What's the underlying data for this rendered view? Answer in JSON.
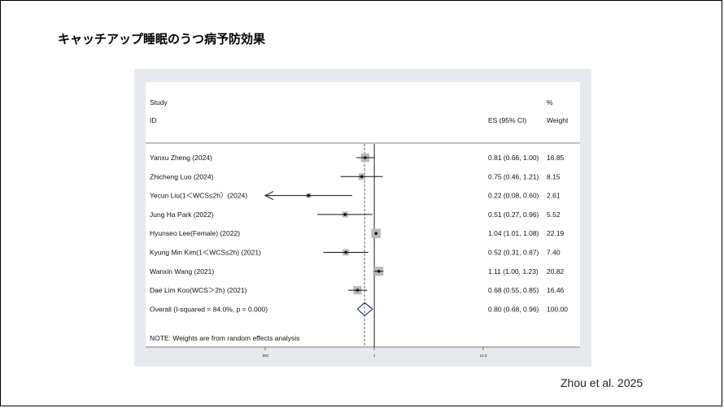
{
  "slide": {
    "title": "キャッチアップ睡眠のうつ病予防効果",
    "credit": "Zhou et al. 2025"
  },
  "headers": {
    "study_line1": "Study",
    "study_line2": "ID",
    "es": "ES (95% CI)",
    "weight_line1": "%",
    "weight_line2": "Weight"
  },
  "note": "NOTE: Weights are from random effects analysis",
  "chart_data": {
    "type": "forest",
    "scale": "log",
    "x_ticks": [
      {
        "value": 0.081,
        "label": ".081"
      },
      {
        "value": 1,
        "label": "1"
      },
      {
        "value": 12.3,
        "label": "12.3"
      }
    ],
    "null_line": 1,
    "pooled_line": 0.8,
    "studies": [
      {
        "label": "Yanxu Zheng (2024)",
        "es": 0.81,
        "lower": 0.66,
        "upper": 1.0,
        "es_text": "0.81 (0.66, 1.00)",
        "weight": 16.85,
        "weight_text": "16.85"
      },
      {
        "label": "Zhicheng Luo (2024)",
        "es": 0.75,
        "lower": 0.46,
        "upper": 1.21,
        "es_text": "0.75 (0.46, 1.21)",
        "weight": 8.15,
        "weight_text": "8.15"
      },
      {
        "label": "Yecun Liu(1＜WCS≤2h）(2024)",
        "es": 0.22,
        "lower": 0.08,
        "upper": 0.6,
        "es_text": "0.22 (0.08, 0.60)",
        "weight": 2.61,
        "weight_text": "2.61"
      },
      {
        "label": "Jung Ha Park (2022)",
        "es": 0.51,
        "lower": 0.27,
        "upper": 0.96,
        "es_text": "0.51 (0.27, 0.96)",
        "weight": 5.52,
        "weight_text": "5.52"
      },
      {
        "label": "Hyunseo Lee(Female) (2022)",
        "es": 1.04,
        "lower": 1.01,
        "upper": 1.08,
        "es_text": "1.04 (1.01, 1.08)",
        "weight": 22.19,
        "weight_text": "22.19"
      },
      {
        "label": "Kyung Min Kim(1＜WCS≤2h) (2021)",
        "es": 0.52,
        "lower": 0.31,
        "upper": 0.87,
        "es_text": "0.52 (0.31, 0.87)",
        "weight": 7.4,
        "weight_text": "7.40"
      },
      {
        "label": "Wanxin Wang (2021)",
        "es": 1.11,
        "lower": 1.0,
        "upper": 1.23,
        "es_text": "1.11 (1.00, 1.23)",
        "weight": 20.82,
        "weight_text": "20.82"
      },
      {
        "label": "Dae Lim Koo(WCS＞2h) (2021)",
        "es": 0.68,
        "lower": 0.55,
        "upper": 0.85,
        "es_text": "0.68 (0.55, 0.85)",
        "weight": 16.46,
        "weight_text": "16.46"
      }
    ],
    "overall": {
      "label": "Overall  (I-squared = 84.0%, p = 0.000)",
      "es": 0.8,
      "lower": 0.68,
      "upper": 0.96,
      "es_text": "0.80 (0.68, 0.96)",
      "weight_text": "100.00"
    }
  }
}
